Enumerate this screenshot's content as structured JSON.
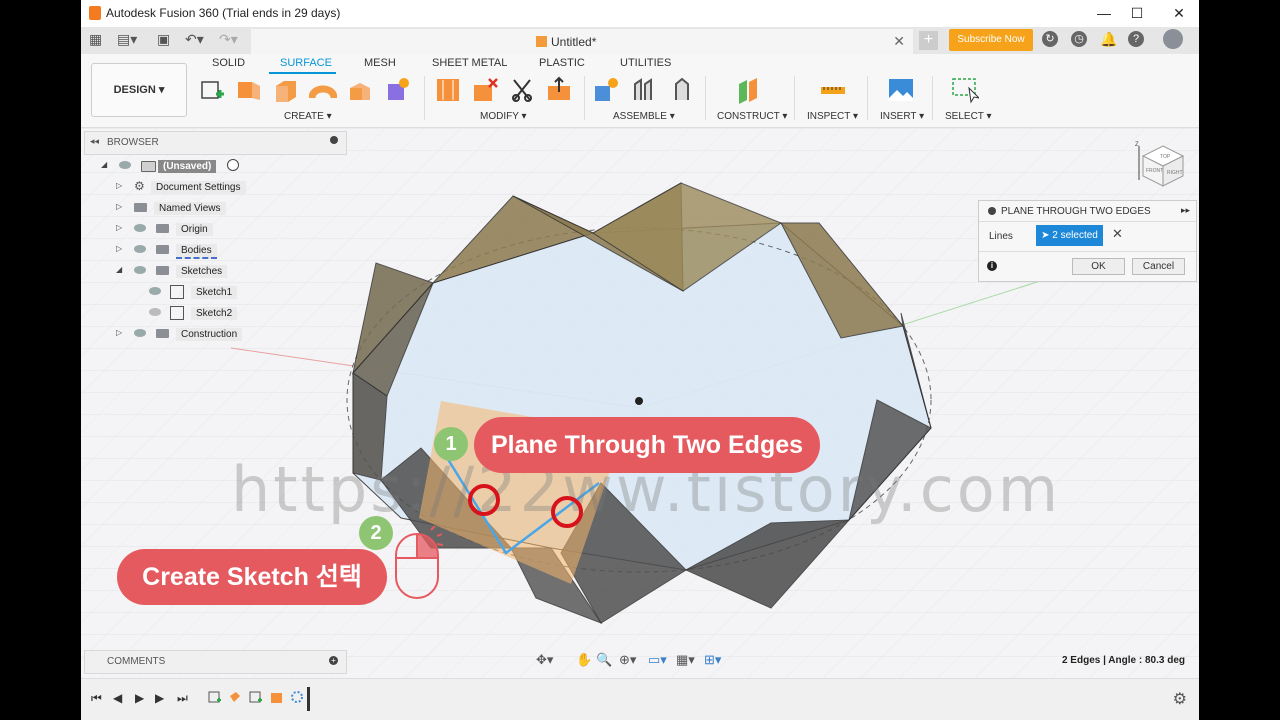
{
  "window": {
    "title": "Autodesk Fusion 360 (Trial ends in 29 days)",
    "minimize": "—",
    "maximize": "☐",
    "close": "✕"
  },
  "tabbar": {
    "doc_title": "Untitled*",
    "subscribe": "Subscribe Now"
  },
  "toolbar": {
    "design": "DESIGN ▾",
    "tabs": [
      "SOLID",
      "SURFACE",
      "MESH",
      "SHEET METAL",
      "PLASTIC",
      "UTILITIES"
    ],
    "active_tab": "SURFACE",
    "groups": [
      "CREATE ▾",
      "MODIFY ▾",
      "ASSEMBLE ▾",
      "CONSTRUCT ▾",
      "INSPECT ▾",
      "INSERT ▾",
      "SELECT ▾"
    ]
  },
  "browser": {
    "title": "BROWSER",
    "items": [
      {
        "label": "(Unsaved)"
      },
      {
        "label": "Document Settings"
      },
      {
        "label": "Named Views"
      },
      {
        "label": "Origin"
      },
      {
        "label": "Bodies"
      },
      {
        "label": "Sketches"
      },
      {
        "label": "Sketch1"
      },
      {
        "label": "Sketch2"
      },
      {
        "label": "Construction"
      }
    ]
  },
  "dialog": {
    "title": "PLANE THROUGH TWO EDGES",
    "field_label": "Lines",
    "selection": "2 selected",
    "ok": "OK",
    "cancel": "Cancel"
  },
  "comments": {
    "title": "COMMENTS"
  },
  "status": "2 Edges | Angle : 80.3 deg",
  "overlay": {
    "step1_number": "1",
    "step1_text": "Plane Through Two Edges",
    "step2_number": "2",
    "step2_text": "Create Sketch 선택",
    "watermark": "https://22ww.tistory.com"
  },
  "viewcube": {
    "top": "TOP",
    "front": "FRONT",
    "right": "RIGHT"
  },
  "colors": {
    "accent": "#0696d7",
    "callout": "#e55a5f",
    "step": "#8ec572",
    "subscribe": "#f6a21a"
  }
}
